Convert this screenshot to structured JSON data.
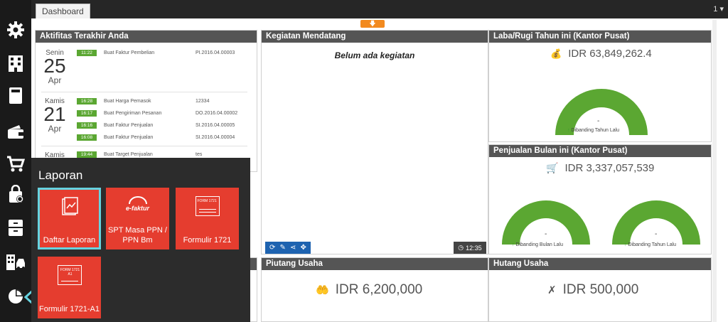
{
  "tabs": {
    "dashboard_label": "Dashboard",
    "count": "1"
  },
  "colors": {
    "accent_orange": "#f28a1f",
    "gauge_green": "#5ba732",
    "tile_red": "#e53d2f",
    "panel_header": "#555555"
  },
  "rail": {
    "icons": [
      "gear-icon",
      "buildings-icon",
      "book-icon",
      "wallet-icon",
      "cart-icon",
      "bag-icon",
      "archive-icon",
      "city-car-icon",
      "pie-chart-icon"
    ]
  },
  "activity": {
    "title": "Aktifitas Terakhir Anda",
    "groups": [
      {
        "day_name": "Senin",
        "day": "25",
        "month": "Apr",
        "rows": [
          {
            "time": "11:22",
            "text": "Buat Faktur Pembelian",
            "ref": "PI.2016.04.00003"
          }
        ]
      },
      {
        "day_name": "Kamis",
        "day": "21",
        "month": "Apr",
        "rows": [
          {
            "time": "16:28",
            "text": "Buat Harga Pemasok",
            "ref": "12334"
          },
          {
            "time": "16:17",
            "text": "Buat Pengiriman Pesanan",
            "ref": "DO.2016.04.00002"
          },
          {
            "time": "16:16",
            "text": "Buat Faktur Penjualan",
            "ref": "SI.2016.04.00005"
          },
          {
            "time": "16:08",
            "text": "Buat Faktur Penjualan",
            "ref": "SI.2016.04.00004"
          }
        ]
      },
      {
        "day_name": "Kamis",
        "day": "",
        "month": "",
        "rows": [
          {
            "time": "19:44",
            "text": "Buat Target Penjualan",
            "ref": "tes"
          }
        ]
      }
    ]
  },
  "kegiatan": {
    "title": "Kegiatan Mendatang",
    "empty_text": "Belum ada kegiatan",
    "clock_time": "12:35"
  },
  "laba": {
    "title": "Laba/Rugi Tahun ini (Kantor Pusat)",
    "amount": "IDR 63,849,262.4",
    "gauge_value": "-",
    "note": "Dibanding Tahun Lalu"
  },
  "penjualan": {
    "title": "Penjualan Bulan ini (Kantor Pusat)",
    "amount": "IDR 3,337,057,539",
    "gauges": [
      {
        "value": "-",
        "note": "Dibanding Bulan Lalu"
      },
      {
        "value": "-",
        "note": "Dibanding Tahun Lalu"
      }
    ]
  },
  "piutang": {
    "title": "Piutang Usaha",
    "amount": "IDR 6,200,000"
  },
  "hutang": {
    "title": "Hutang Usaha",
    "amount": "IDR 500,000"
  },
  "laporan": {
    "title": "Laporan",
    "tiles": [
      {
        "label": "Daftar Laporan",
        "icon": "report-icon"
      },
      {
        "label": "SPT Masa PPN / PPN Bm",
        "icon": "efaktur-icon",
        "logo_text": "e-faktur"
      },
      {
        "label": "Formulir 1721",
        "icon": "form-1721-icon",
        "logo_text": "FORM 1721"
      },
      {
        "label": "Formulir 1721-A1",
        "icon": "form-1721-a1-icon",
        "logo_text": "FORM 1721 A1"
      }
    ]
  }
}
